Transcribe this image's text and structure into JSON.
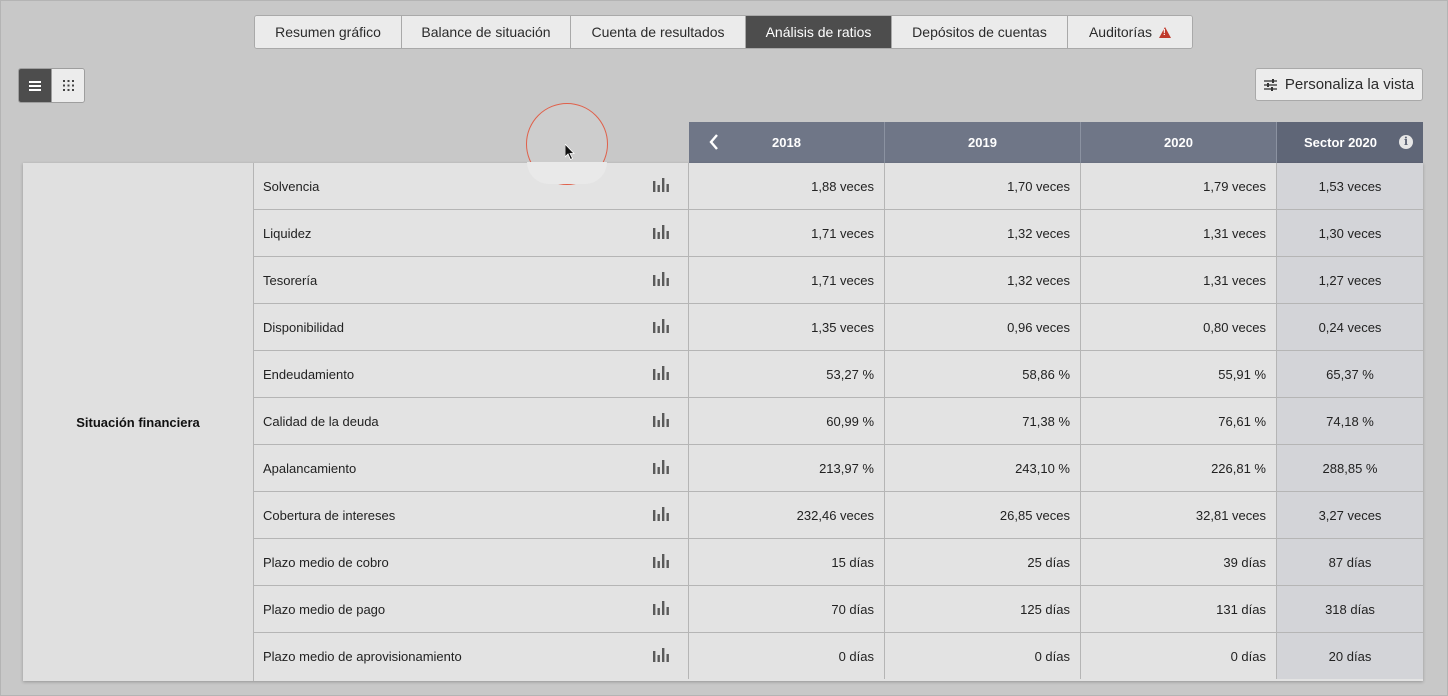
{
  "tabs": [
    {
      "label": "Resumen gráfico",
      "active": false
    },
    {
      "label": "Balance de situación",
      "active": false
    },
    {
      "label": "Cuenta de resultados",
      "active": false
    },
    {
      "label": "Análisis de ratios",
      "active": true
    },
    {
      "label": "Depósitos de cuentas",
      "active": false
    },
    {
      "label": "Auditorías",
      "active": false,
      "icon": "warning-icon"
    }
  ],
  "view_toggles": [
    {
      "icon": "list-view-icon",
      "active": true
    },
    {
      "icon": "grid-view-icon",
      "active": false
    }
  ],
  "customize_button": {
    "label": "Personaliza la vista",
    "icon": "sliders-icon"
  },
  "columns": {
    "years": [
      "2018",
      "2019",
      "2020"
    ],
    "sector": "Sector 2020",
    "prev_icon": "chevron-left-icon",
    "info_icon": "info-icon"
  },
  "group": {
    "label": "Situación financiera"
  },
  "rows": [
    {
      "label": "Solvencia",
      "v2018": "1,88 veces",
      "v2019": "1,70 veces",
      "v2020": "1,79 veces",
      "sector": "1,53 veces"
    },
    {
      "label": "Liquidez",
      "v2018": "1,71 veces",
      "v2019": "1,32 veces",
      "v2020": "1,31 veces",
      "sector": "1,30 veces"
    },
    {
      "label": "Tesorería",
      "v2018": "1,71 veces",
      "v2019": "1,32 veces",
      "v2020": "1,31 veces",
      "sector": "1,27 veces"
    },
    {
      "label": "Disponibilidad",
      "v2018": "1,35 veces",
      "v2019": "0,96 veces",
      "v2020": "0,80 veces",
      "sector": "0,24 veces"
    },
    {
      "label": "Endeudamiento",
      "v2018": "53,27 %",
      "v2019": "58,86 %",
      "v2020": "55,91 %",
      "sector": "65,37 %"
    },
    {
      "label": "Calidad de la deuda",
      "v2018": "60,99 %",
      "v2019": "71,38 %",
      "v2020": "76,61 %",
      "sector": "74,18 %"
    },
    {
      "label": "Apalancamiento",
      "v2018": "213,97 %",
      "v2019": "243,10 %",
      "v2020": "226,81 %",
      "sector": "288,85 %"
    },
    {
      "label": "Cobertura de intereses",
      "v2018": "232,46 veces",
      "v2019": "26,85 veces",
      "v2020": "32,81 veces",
      "sector": "3,27 veces"
    },
    {
      "label": "Plazo medio de cobro",
      "v2018": "15 días",
      "v2019": "25 días",
      "v2020": "39 días",
      "sector": "87 días"
    },
    {
      "label": "Plazo medio de pago",
      "v2018": "70 días",
      "v2019": "125 días",
      "v2020": "131 días",
      "sector": "318 días"
    },
    {
      "label": "Plazo medio de aprovisionamiento",
      "v2018": "0 días",
      "v2019": "0 días",
      "v2020": "0 días",
      "sector": "20 días"
    }
  ],
  "colors": {
    "header": "#6f7687",
    "sector_header": "#5f6677",
    "sector_cell": "#d3d4d8",
    "active_tab": "#4d4d4d",
    "warning": "#c0392b"
  }
}
